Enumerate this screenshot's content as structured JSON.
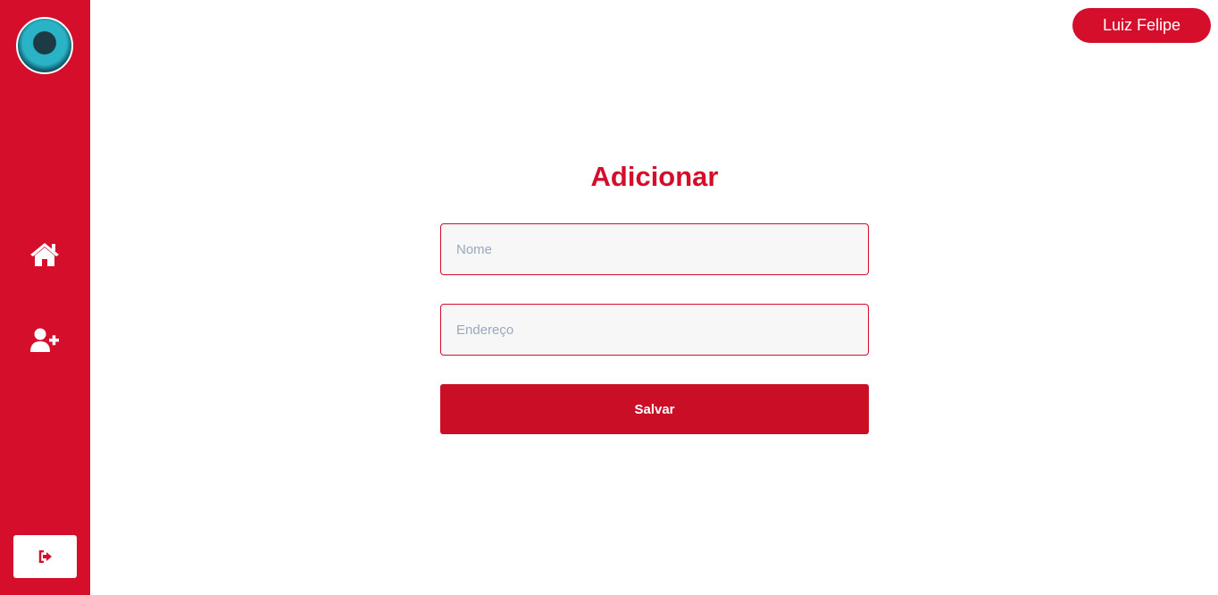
{
  "colors": {
    "brand": "#d50f2b",
    "button": "#c90e25"
  },
  "sidebar": {
    "icons": [
      "home-icon",
      "user-plus-icon",
      "logout-icon"
    ]
  },
  "header": {
    "user_name": "Luiz Felipe"
  },
  "form": {
    "title": "Adicionar",
    "name_placeholder": "Nome",
    "address_placeholder": "Endereço",
    "save_label": "Salvar"
  }
}
